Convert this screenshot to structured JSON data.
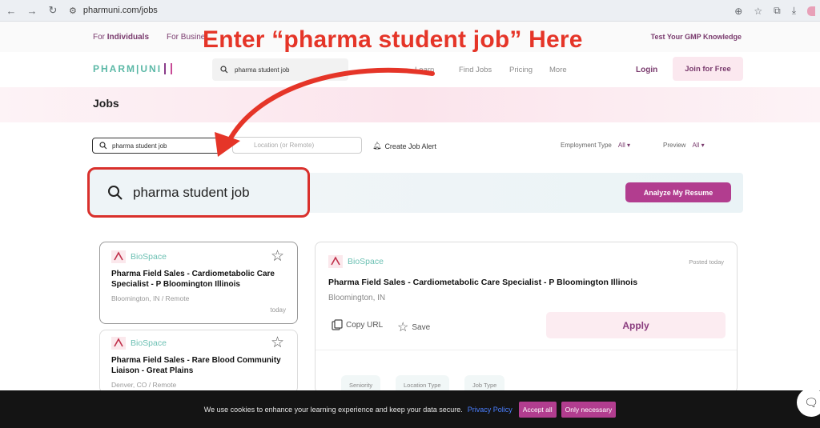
{
  "browser": {
    "url": "pharmuni.com/jobs"
  },
  "topbar": {
    "for_individuals_prefix": "For",
    "for_individuals_bold": "Individuals",
    "for_business": "For Busine",
    "test_link": "Test Your GMP Knowledge"
  },
  "annotation": {
    "text": "Enter “pharma student job” Here"
  },
  "header": {
    "logo": "PHARM|UNI",
    "search_value": "pharma student job",
    "nav": [
      "Learn",
      "Find Jobs",
      "Pricing",
      "More"
    ],
    "login": "Login",
    "join": "Join for Free"
  },
  "page": {
    "title": "Jobs"
  },
  "filters": {
    "search_value": "pharma student job",
    "location_placeholder": "Location (or Remote)",
    "create_alert": "Create Job Alert",
    "employment_type_label": "Employment Type",
    "employment_type_value": "All",
    "preview_label": "Preview",
    "preview_value": "All"
  },
  "highlight": {
    "search_value": "pharma student job"
  },
  "resume": {
    "button": "Analyze My Resume"
  },
  "jobs": [
    {
      "company": "BioSpace",
      "title": "Pharma Field Sales - Cardiometabolic Care Specialist - P Bloomington Illinois",
      "location": "Bloomington, IN / Remote",
      "time": "today"
    },
    {
      "company": "BioSpace",
      "title": "Pharma Field Sales - Rare Blood Community Liaison - Great Plains",
      "location": "Denver, CO / Remote"
    }
  ],
  "detail": {
    "company": "BioSpace",
    "posted": "Posted today",
    "title": "Pharma Field Sales - Cardiometabolic Care Specialist - P Bloomington Illinois",
    "location": "Bloomington, IN",
    "copy_url": "Copy URL",
    "save": "Save",
    "apply": "Apply",
    "chips": [
      "Seniority",
      "Location Type",
      "Job Type"
    ]
  },
  "cookie": {
    "text": "We use cookies to enhance your learning experience and keep your data secure.",
    "policy": "Privacy Policy",
    "accept": "Accept all",
    "necessary": "Only necessary"
  },
  "colors": {
    "brand_purple": "#b23d8f",
    "annotation_red": "#e53528",
    "teal": "#6cc0b3"
  }
}
